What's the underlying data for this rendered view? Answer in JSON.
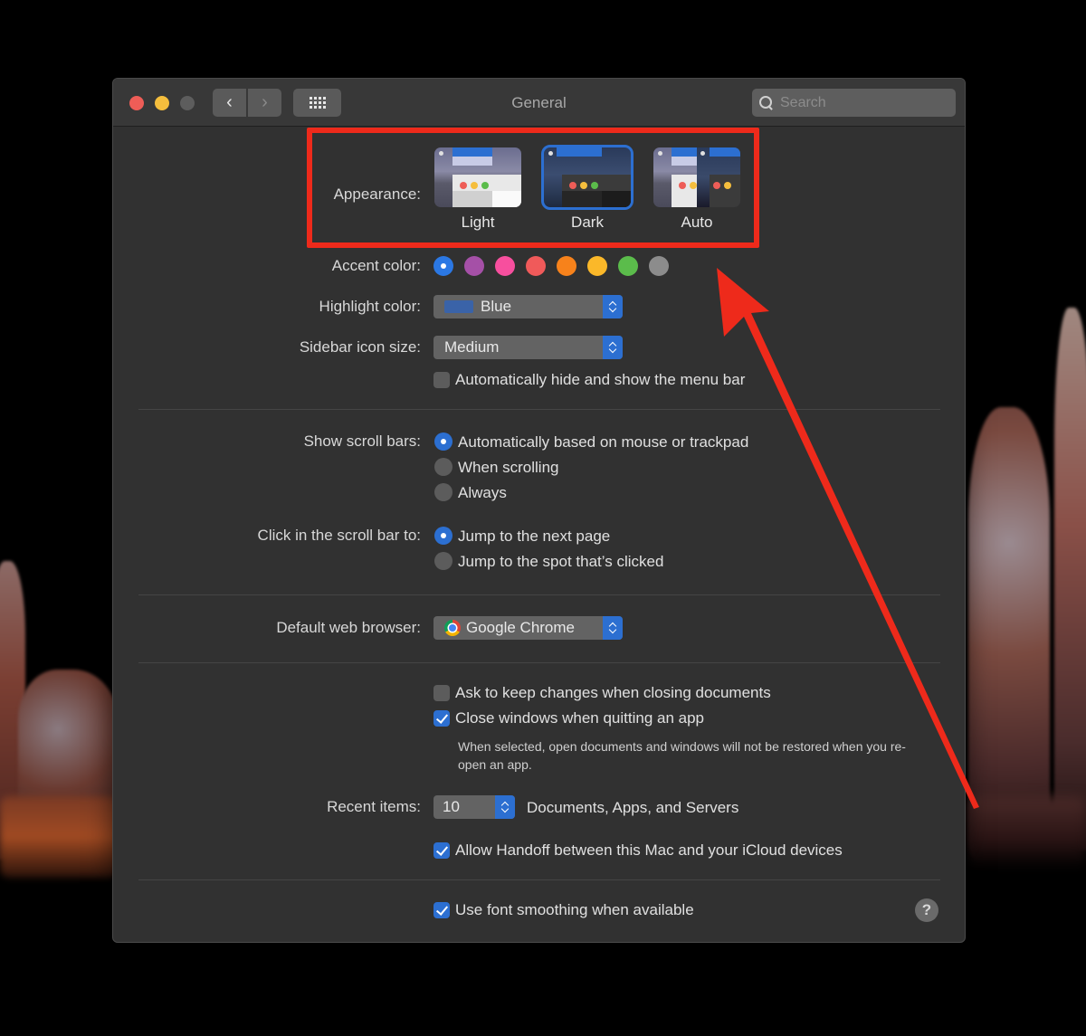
{
  "window": {
    "title": "General",
    "search_placeholder": "Search"
  },
  "appearance": {
    "label": "Appearance:",
    "options": [
      {
        "label": "Light",
        "selected": false
      },
      {
        "label": "Dark",
        "selected": true
      },
      {
        "label": "Auto",
        "selected": false
      }
    ]
  },
  "accent": {
    "label": "Accent color:",
    "colors": [
      "#2b78e4",
      "#a550a7",
      "#f74f9e",
      "#f05a5a",
      "#f7821b",
      "#fbb829",
      "#5bbc4b",
      "#8c8c8c"
    ],
    "selected_index": 0
  },
  "highlight": {
    "label": "Highlight color:",
    "value": "Blue",
    "chip_color": "#3a63a8"
  },
  "sidebar_icon_size": {
    "label": "Sidebar icon size:",
    "value": "Medium"
  },
  "auto_hide_menu": {
    "label": "Automatically hide and show the menu bar",
    "checked": false
  },
  "scroll_bars": {
    "label": "Show scroll bars:",
    "options": [
      {
        "label": "Automatically based on mouse or trackpad",
        "checked": true
      },
      {
        "label": "When scrolling",
        "checked": false
      },
      {
        "label": "Always",
        "checked": false
      }
    ]
  },
  "click_scroll": {
    "label": "Click in the scroll bar to:",
    "options": [
      {
        "label": "Jump to the next page",
        "checked": true
      },
      {
        "label": "Jump to the spot that’s clicked",
        "checked": false
      }
    ]
  },
  "browser": {
    "label": "Default web browser:",
    "value": "Google Chrome"
  },
  "documents": {
    "ask_keep": {
      "label": "Ask to keep changes when closing documents",
      "checked": false
    },
    "close_windows": {
      "label": "Close windows when quitting an app",
      "checked": true
    },
    "note": "When selected, open documents and windows will not be restored when you re-open an app."
  },
  "recent_items": {
    "label": "Recent items:",
    "value": "10",
    "suffix": "Documents, Apps, and Servers"
  },
  "handoff": {
    "label": "Allow Handoff between this Mac and your iCloud devices",
    "checked": true
  },
  "font_smoothing": {
    "label": "Use font smoothing when available",
    "checked": true
  },
  "help": {
    "glyph": "?"
  },
  "annotation": {
    "color": "#ee2a1b"
  }
}
